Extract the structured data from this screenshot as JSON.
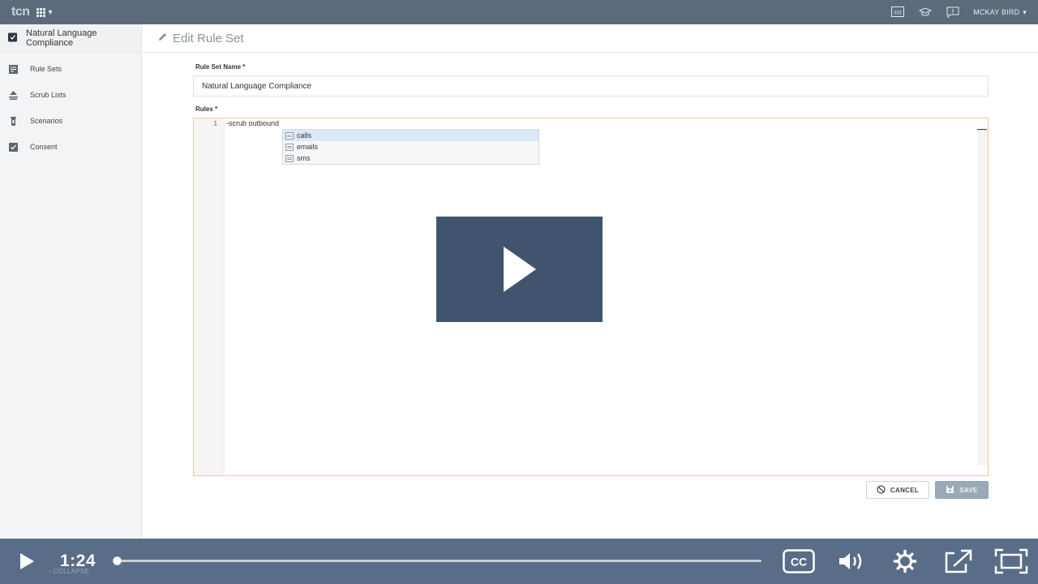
{
  "app": {
    "logo": "tcn",
    "user": "MCKAY BIRD",
    "badge": "302"
  },
  "sidebar": {
    "title": "Natural Language Compliance",
    "items": [
      {
        "label": "Rule Sets",
        "icon": "rule-sets-icon"
      },
      {
        "label": "Scrub Lists",
        "icon": "scrub-lists-icon"
      },
      {
        "label": "Scenarios",
        "icon": "scenarios-icon"
      },
      {
        "label": "Consent",
        "icon": "consent-icon"
      }
    ],
    "collapse_label": "COLLAPSE"
  },
  "header": {
    "title": "Edit Rule Set"
  },
  "form": {
    "name_label": "Rule Set Name *",
    "name_value": "Natural Language Compliance",
    "rules_label": "Rules *",
    "editor": {
      "line_number": "1",
      "line_text": "-scrub outbound",
      "suggestions": [
        "calls",
        "emails",
        "sms"
      ]
    },
    "cancel_label": "CANCEL",
    "save_label": "SAVE"
  },
  "video": {
    "time": "1:24",
    "progress": 0.0
  },
  "colors": {
    "topbar": "#5b6b7b",
    "controls": "#5a6d88",
    "overlay": "#41546f",
    "editor_border": "#f0c99a"
  }
}
